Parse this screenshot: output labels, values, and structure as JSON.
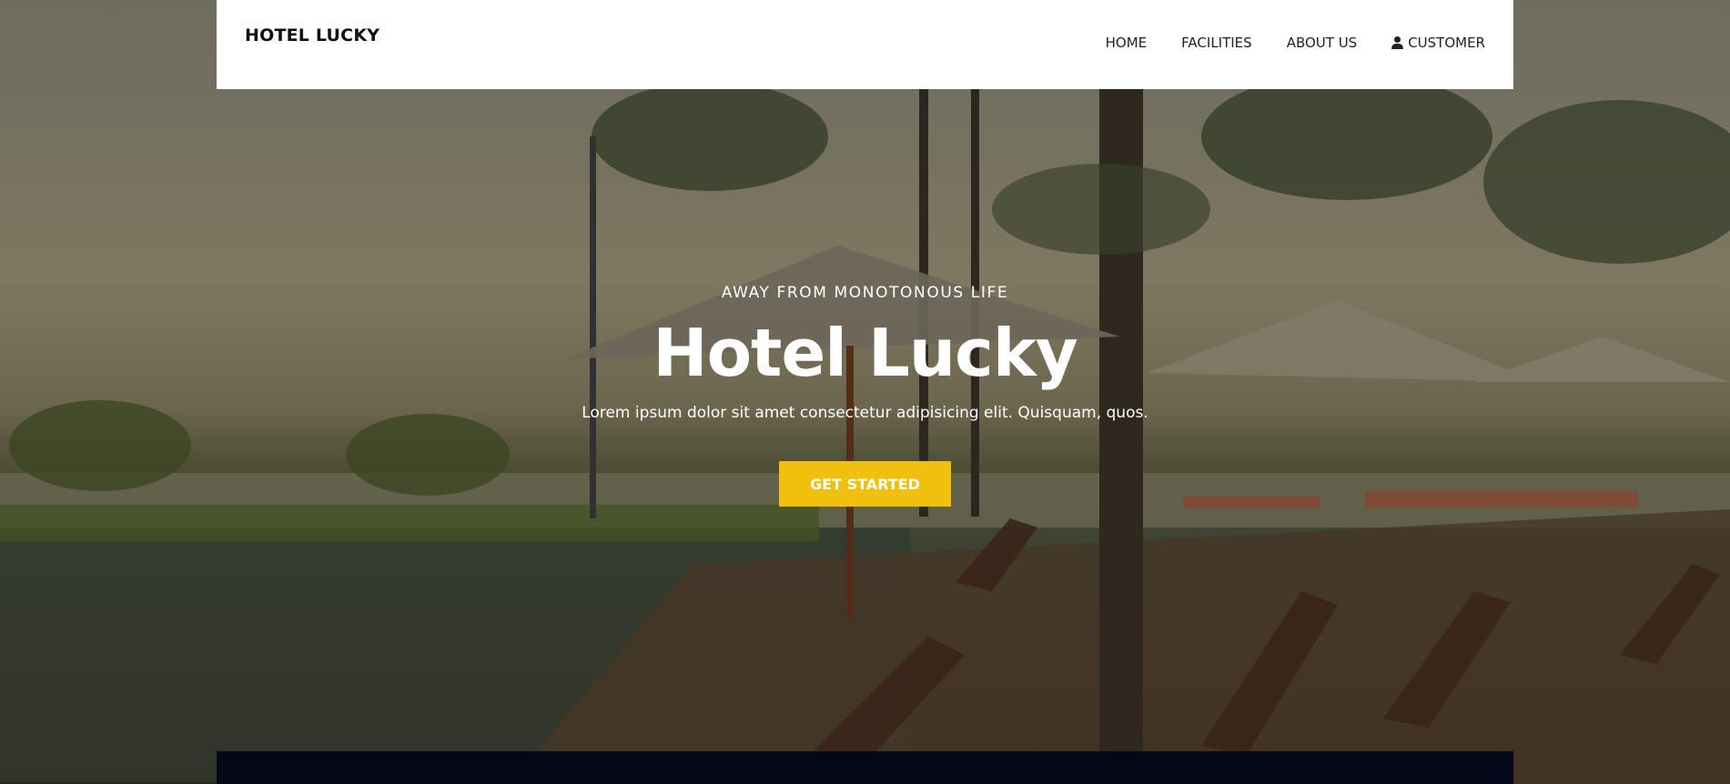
{
  "brand": {
    "name": "HOTEL LUCKY"
  },
  "nav": {
    "items": [
      {
        "label": "HOME"
      },
      {
        "label": "FACILITIES"
      },
      {
        "label": "ABOUT US"
      },
      {
        "label": "CUSTOMER",
        "icon": "user-icon"
      }
    ]
  },
  "hero": {
    "eyebrow": "AWAY FROM MONOTONOUS LIFE",
    "title": "Hotel Lucky",
    "tagline": "Lorem ipsum dolor sit amet consectetur adipisicing elit. Quisquam, quos.",
    "cta_label": "GET STARTED",
    "background_image": "tropical-resort-pool-scene"
  },
  "colors": {
    "accent": "#f1c00f",
    "header_bg": "#ffffff",
    "footer_bar": "#050818",
    "text_light": "#ffffff",
    "text_dark": "#222222"
  }
}
